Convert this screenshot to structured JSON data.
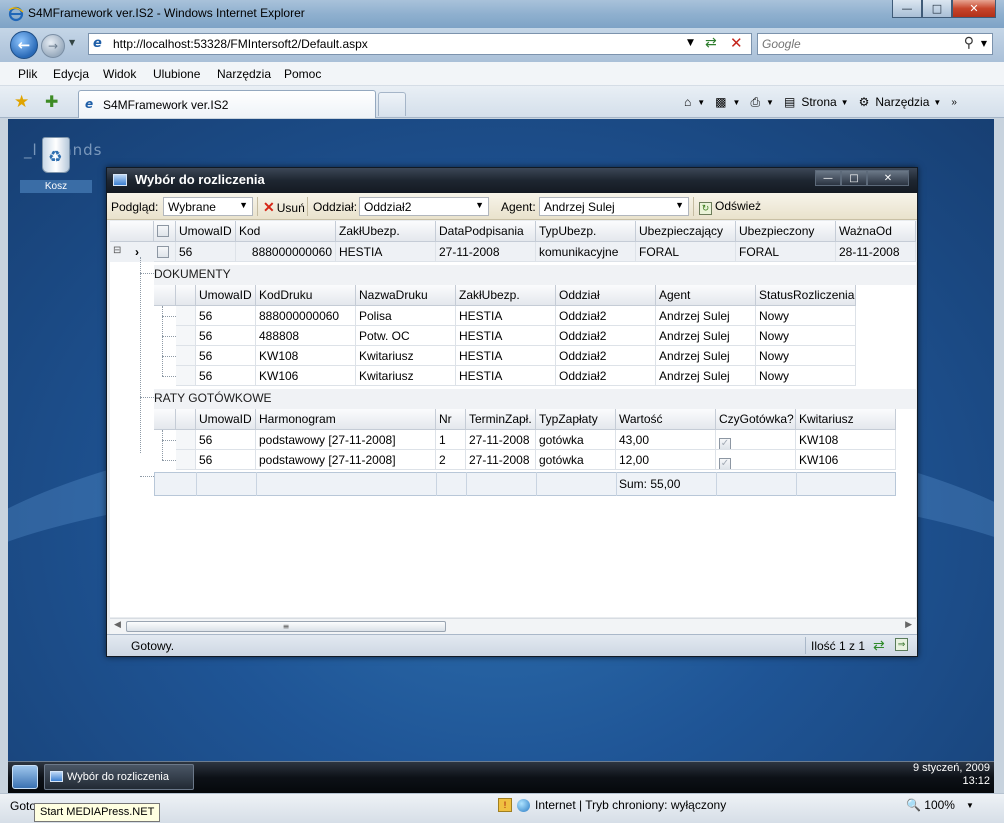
{
  "browser": {
    "title": "S4MFramework ver.IS2 - Windows Internet Explorer",
    "url": "http://localhost:53328/FMIntersoft2/Default.aspx",
    "search_placeholder": "Google",
    "menu": [
      "Plik",
      "Edycja",
      "Widok",
      "Ulubione",
      "Narzędzia",
      "Pomoc"
    ],
    "tab_label": "S4MFramework ver.IS2",
    "tools": {
      "strona": "Strona",
      "narzedzia": "Narzędzia"
    },
    "status": {
      "left": "Gotowe",
      "zone": "Internet | Tryb chroniony: wyłączony",
      "zoom": "100%"
    },
    "tooltip": "Start MEDIAPress.NET"
  },
  "desktop": {
    "recycle_label": "Kosz",
    "watermark": "_l    n_ands"
  },
  "app": {
    "title": "Wybór do rozliczenia",
    "toolbar": {
      "podglad_label": "Podgląd:",
      "podglad_value": "Wybrane",
      "usun_label": "Usuń",
      "oddzial_label": "Oddział:",
      "oddzial_value": "Oddział2",
      "agent_label": "Agent:",
      "agent_value": "Andrzej Sulej",
      "refresh_label": "Odśwież"
    },
    "master": {
      "columns": [
        "UmowaID",
        "Kod",
        "ZakłUbezp.",
        "DataPodpisania",
        "TypUbezp.",
        "Ubezpieczający",
        "Ubezpieczony",
        "WażnaOd"
      ],
      "row": [
        "56",
        "888000000060",
        "HESTIA",
        "27-11-2008",
        "komunikacyjne",
        "FORAL",
        "FORAL",
        "28-11-2008"
      ]
    },
    "dokumenty": {
      "title": "DOKUMENTY",
      "columns": [
        "UmowaID",
        "KodDruku",
        "NazwaDruku",
        "ZakłUbezp.",
        "Oddział",
        "Agent",
        "StatusRozliczenia"
      ],
      "rows": [
        [
          "56",
          "888000000060",
          "Polisa",
          "HESTIA",
          "Oddział2",
          "Andrzej Sulej",
          "Nowy"
        ],
        [
          "56",
          "488808",
          "Potw. OC",
          "HESTIA",
          "Oddział2",
          "Andrzej Sulej",
          "Nowy"
        ],
        [
          "56",
          "KW108",
          "Kwitariusz",
          "HESTIA",
          "Oddział2",
          "Andrzej Sulej",
          "Nowy"
        ],
        [
          "56",
          "KW106",
          "Kwitariusz",
          "HESTIA",
          "Oddział2",
          "Andrzej Sulej",
          "Nowy"
        ]
      ]
    },
    "raty": {
      "title": "RATY GOTÓWKOWE",
      "columns": [
        "UmowaID",
        "Harmonogram",
        "Nr",
        "TerminZapł.",
        "TypZapłaty",
        "Wartość",
        "CzyGotówka?",
        "Kwitariusz"
      ],
      "rows": [
        [
          "56",
          "podstawowy [27-11-2008]",
          "1",
          "27-11-2008",
          "gotówka",
          "43,00",
          true,
          "KW108"
        ],
        [
          "56",
          "podstawowy [27-11-2008]",
          "2",
          "27-11-2008",
          "gotówka",
          "12,00",
          true,
          "KW106"
        ]
      ],
      "sum": "Sum: 55,00"
    },
    "status": {
      "text": "Gotowy.",
      "count": "Ilość 1 z 1"
    }
  },
  "taskbar": {
    "item": "Wybór do rozliczenia",
    "date": "9 styczeń, 2009",
    "time": "13:12"
  }
}
